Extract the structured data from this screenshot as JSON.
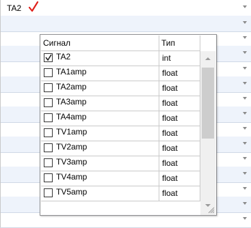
{
  "combo": {
    "selected_value": "TA2",
    "valid_icon": "checkmark-icon",
    "valid_color": "#e0201b"
  },
  "popup": {
    "columns": {
      "signal": "Сигнал",
      "type": "Тип"
    },
    "rows": [
      {
        "signal": "TA2",
        "type": "int",
        "checked": true
      },
      {
        "signal": "TA1amp",
        "type": "float",
        "checked": false
      },
      {
        "signal": "TA2amp",
        "type": "float",
        "checked": false
      },
      {
        "signal": "TA3amp",
        "type": "float",
        "checked": false
      },
      {
        "signal": "TA4amp",
        "type": "float",
        "checked": false
      },
      {
        "signal": "TV1amp",
        "type": "float",
        "checked": false
      },
      {
        "signal": "TV2amp",
        "type": "float",
        "checked": false
      },
      {
        "signal": "TV3amp",
        "type": "float",
        "checked": false
      },
      {
        "signal": "TV4amp",
        "type": "float",
        "checked": false
      },
      {
        "signal": "TV5amp",
        "type": "float",
        "checked": false
      }
    ]
  }
}
